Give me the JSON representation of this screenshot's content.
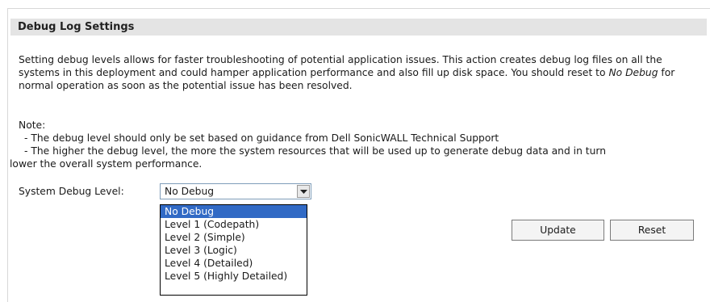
{
  "section": {
    "title": "Debug Log Settings"
  },
  "description": {
    "part1": "Setting debug levels allows for faster troubleshooting of potential application issues. This action creates debug log files on all the systems in this deployment and could hamper application performance and also fill up disk space. You should reset to ",
    "emphasis": "No Debug",
    "part2": " for normal operation as soon as the potential issue has been resolved."
  },
  "note": {
    "heading": "Note:",
    "line1": "- The debug level should only be set based on guidance from Dell SonicWALL Technical Support",
    "line2a": "- The higher the debug level, the more the system resources that will be used up to generate debug data and in turn",
    "line2b": "lower the overall system performance."
  },
  "debug_level": {
    "label": "System Debug Level:",
    "selected": "No Debug",
    "options": [
      "No Debug",
      "Level 1 (Codepath)",
      "Level 2 (Simple)",
      "Level 3 (Logic)",
      "Level 4 (Detailed)",
      "Level 5 (Highly Detailed)"
    ]
  },
  "buttons": {
    "update": "Update",
    "reset": "Reset"
  },
  "colors": {
    "header_bg": "#e4e4e4",
    "selected_option_bg": "#316ac5"
  }
}
